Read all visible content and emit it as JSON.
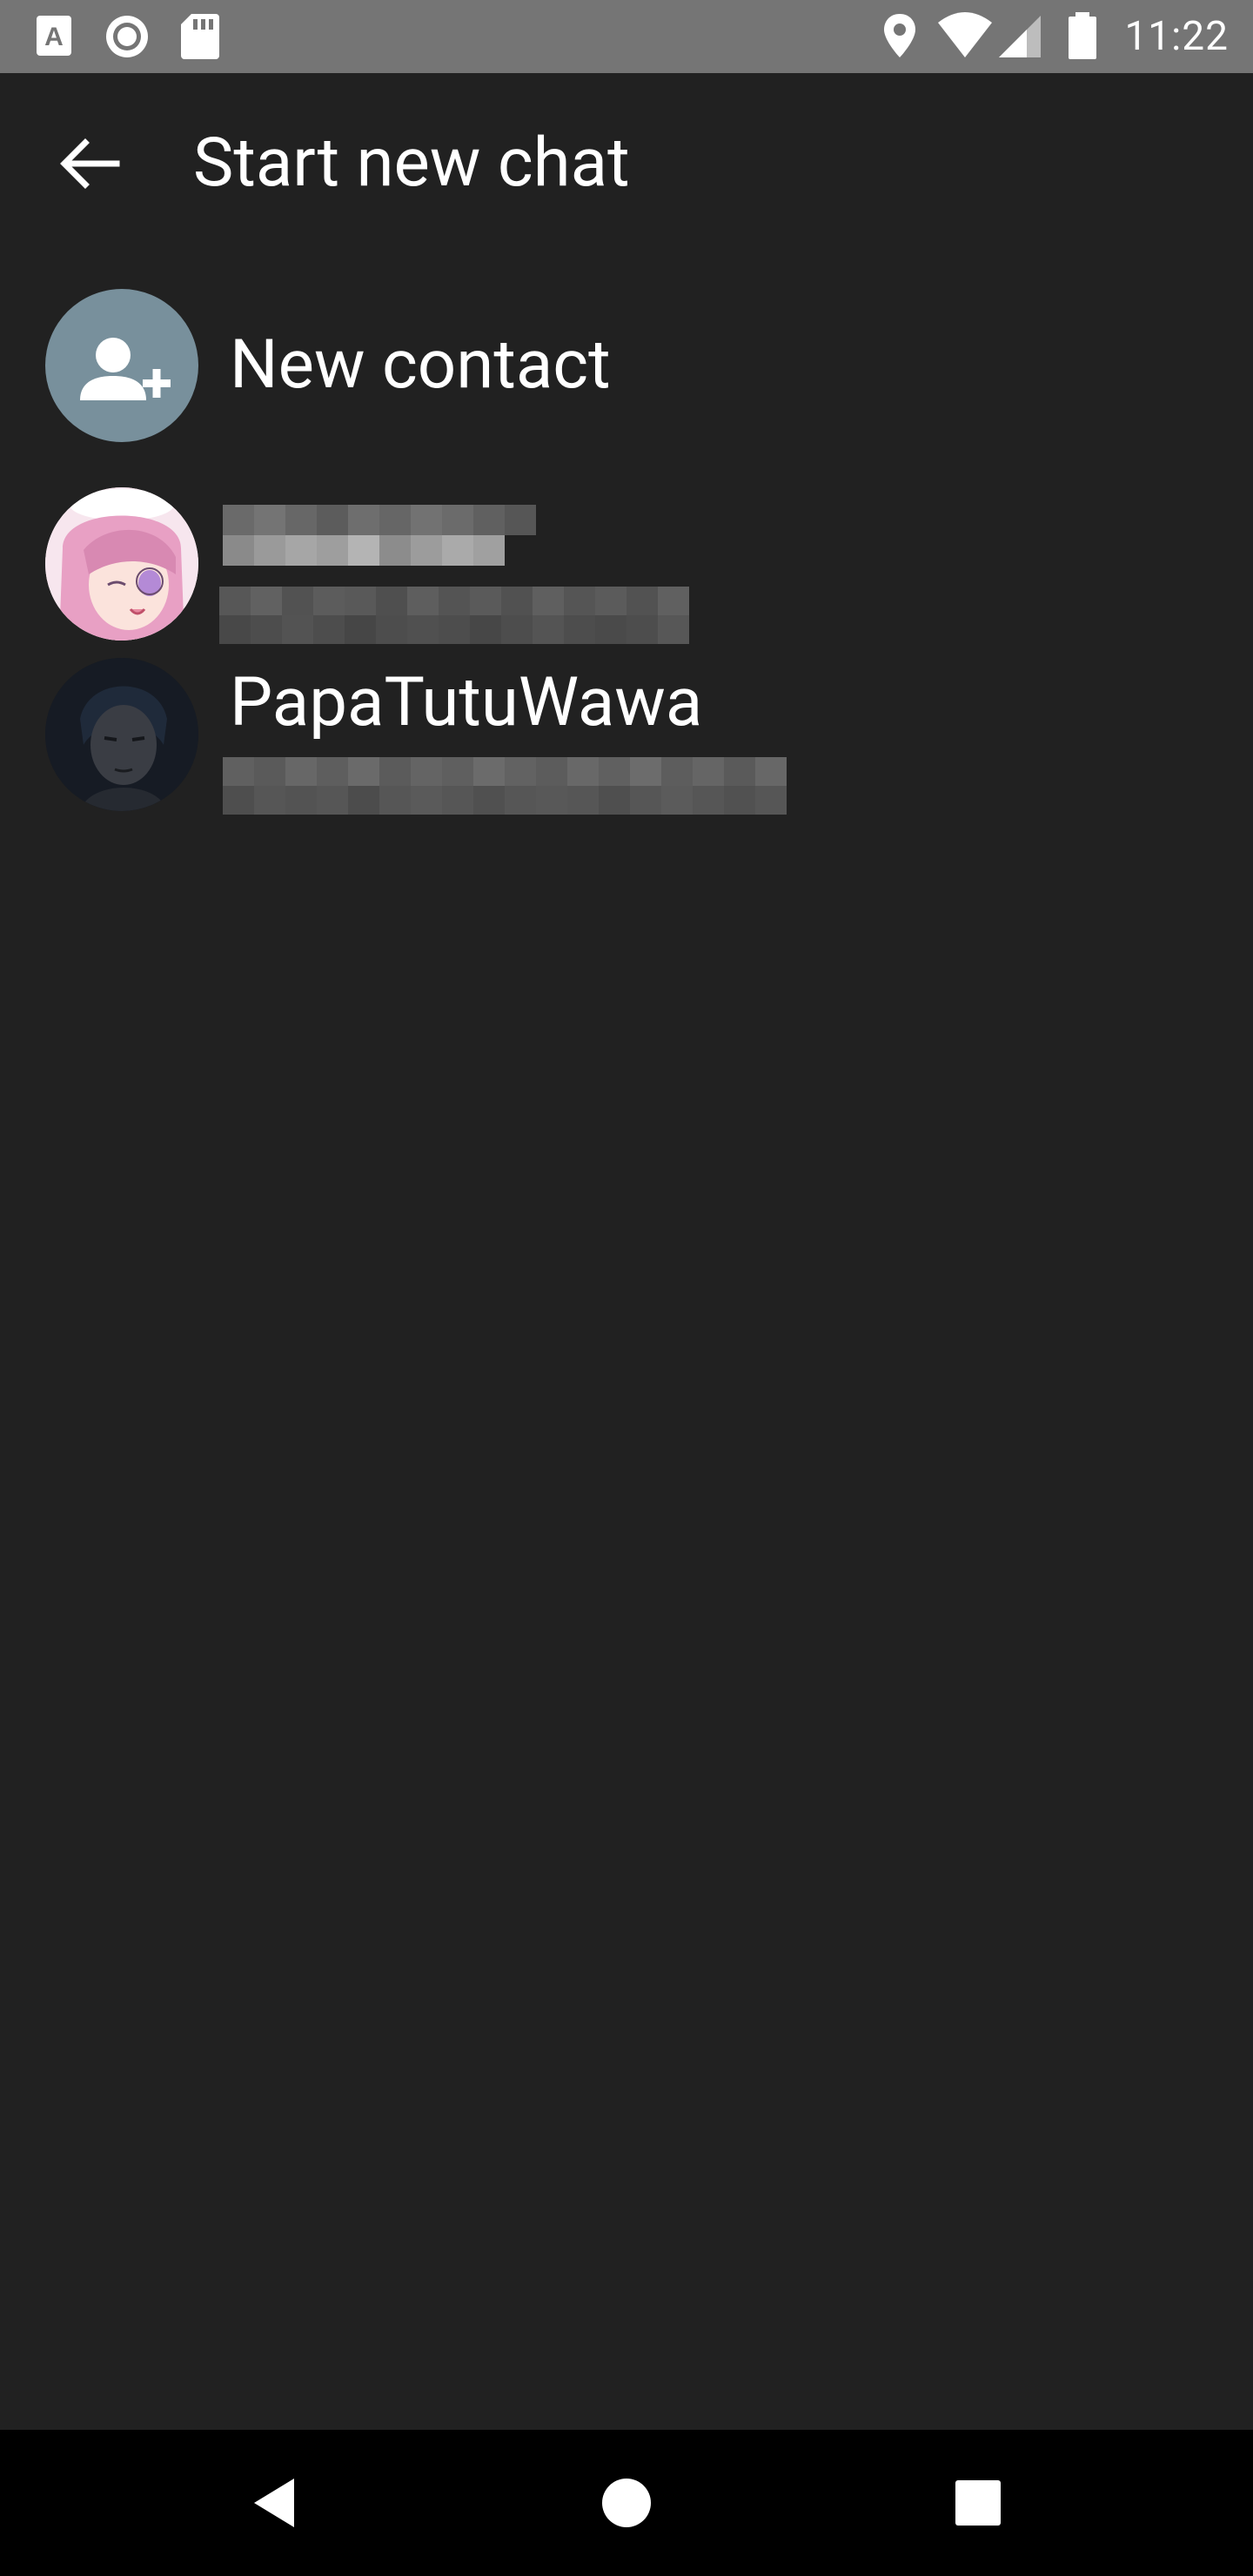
{
  "status_bar": {
    "time": "11:22",
    "left_icons": [
      "accessibility-a-icon",
      "record-icon",
      "sd-card-icon"
    ],
    "right_icons": [
      "location-icon",
      "wifi-icon",
      "signal-icon",
      "battery-icon"
    ]
  },
  "app_bar": {
    "title": "Start new chat",
    "back_icon": "arrow-back-icon"
  },
  "new_contact": {
    "label": "New contact",
    "icon": "person-add-icon",
    "avatar_color": "#78909c"
  },
  "contacts": [
    {
      "name": "",
      "subtitle": ""
    },
    {
      "name": "PapaTutuWawa",
      "subtitle": ""
    }
  ],
  "nav_bar": {
    "buttons": [
      "back-triangle-icon",
      "home-circle-icon",
      "recents-square-icon"
    ]
  },
  "colors": {
    "background": "#212121",
    "status_bar": "#757575",
    "nav_bar": "#000000",
    "text": "#ffffff"
  }
}
